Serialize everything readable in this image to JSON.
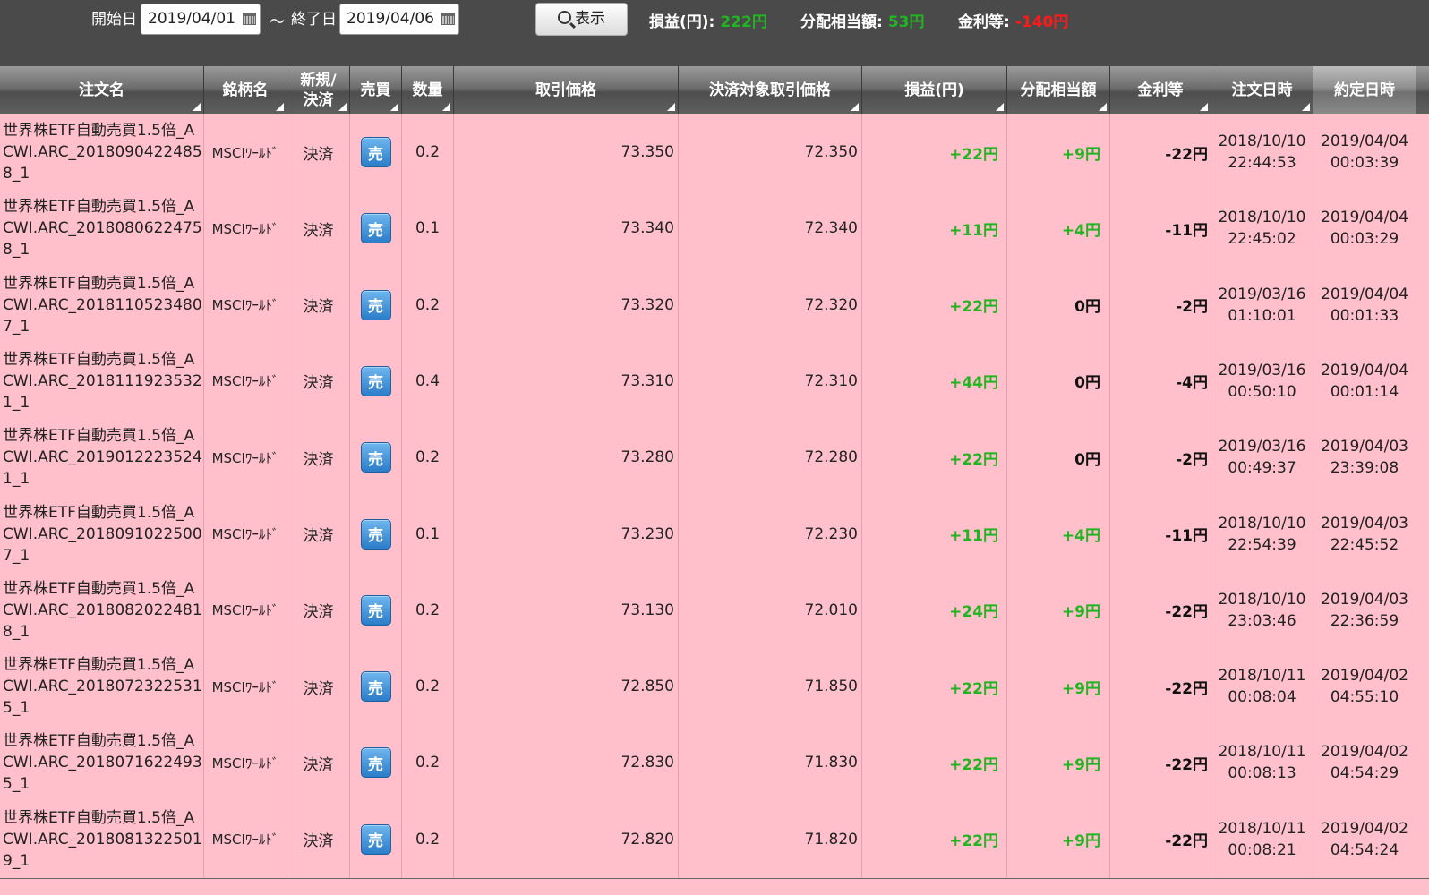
{
  "filter": {
    "start_label": "開始日",
    "start_value": "2019/04/01",
    "tilde": "〜",
    "end_label": "終了日",
    "end_value": "2019/04/06",
    "search_label": "表示"
  },
  "summary": {
    "pl_label": "損益(円):",
    "pl_value": "222円",
    "div_label": "分配相当額:",
    "div_value": "53円",
    "int_label": "金利等:",
    "int_value": "-140円",
    "colors": {
      "positive": "#22b422",
      "negative": "#ff1a1a"
    }
  },
  "columns": {
    "name": "注文名",
    "issue": "銘柄名",
    "type": "新規/決済",
    "side": "売買",
    "qty": "数量",
    "price": "取引価格",
    "sprice": "決済対象取引価格",
    "pl": "損益(円)",
    "div": "分配相当額",
    "int": "金利等",
    "odt": "注文日時",
    "edt": "約定日時"
  },
  "rows": [
    {
      "name": "世界株ETF自動売買1.5倍_ACWI.ARC_20180904224858_1",
      "issue": "MSCIﾜｰﾙﾄﾞ",
      "type": "決済",
      "side": "売",
      "qty": "0.2",
      "price": "73.350",
      "sprice": "72.350",
      "pl": "+22円",
      "div": "+9円",
      "int": "-22円",
      "odt_d": "2018/10/10",
      "odt_t": "22:44:53",
      "edt_d": "2019/04/04",
      "edt_t": "00:03:39"
    },
    {
      "name": "世界株ETF自動売買1.5倍_ACWI.ARC_20180806224758_1",
      "issue": "MSCIﾜｰﾙﾄﾞ",
      "type": "決済",
      "side": "売",
      "qty": "0.1",
      "price": "73.340",
      "sprice": "72.340",
      "pl": "+11円",
      "div": "+4円",
      "int": "-11円",
      "odt_d": "2018/10/10",
      "odt_t": "22:45:02",
      "edt_d": "2019/04/04",
      "edt_t": "00:03:29"
    },
    {
      "name": "世界株ETF自動売買1.5倍_ACWI.ARC_20181105234807_1",
      "issue": "MSCIﾜｰﾙﾄﾞ",
      "type": "決済",
      "side": "売",
      "qty": "0.2",
      "price": "73.320",
      "sprice": "72.320",
      "pl": "+22円",
      "div": "0円",
      "int": "-2円",
      "odt_d": "2019/03/16",
      "odt_t": "01:10:01",
      "edt_d": "2019/04/04",
      "edt_t": "00:01:33"
    },
    {
      "name": "世界株ETF自動売買1.5倍_ACWI.ARC_20181119235321_1",
      "issue": "MSCIﾜｰﾙﾄﾞ",
      "type": "決済",
      "side": "売",
      "qty": "0.4",
      "price": "73.310",
      "sprice": "72.310",
      "pl": "+44円",
      "div": "0円",
      "int": "-4円",
      "odt_d": "2019/03/16",
      "odt_t": "00:50:10",
      "edt_d": "2019/04/04",
      "edt_t": "00:01:14"
    },
    {
      "name": "世界株ETF自動売買1.5倍_ACWI.ARC_20190122235241_1",
      "issue": "MSCIﾜｰﾙﾄﾞ",
      "type": "決済",
      "side": "売",
      "qty": "0.2",
      "price": "73.280",
      "sprice": "72.280",
      "pl": "+22円",
      "div": "0円",
      "int": "-2円",
      "odt_d": "2019/03/16",
      "odt_t": "00:49:37",
      "edt_d": "2019/04/03",
      "edt_t": "23:39:08"
    },
    {
      "name": "世界株ETF自動売買1.5倍_ACWI.ARC_20180910225007_1",
      "issue": "MSCIﾜｰﾙﾄﾞ",
      "type": "決済",
      "side": "売",
      "qty": "0.1",
      "price": "73.230",
      "sprice": "72.230",
      "pl": "+11円",
      "div": "+4円",
      "int": "-11円",
      "odt_d": "2018/10/10",
      "odt_t": "22:54:39",
      "edt_d": "2019/04/03",
      "edt_t": "22:45:52"
    },
    {
      "name": "世界株ETF自動売買1.5倍_ACWI.ARC_20180820224818_1",
      "issue": "MSCIﾜｰﾙﾄﾞ",
      "type": "決済",
      "side": "売",
      "qty": "0.2",
      "price": "73.130",
      "sprice": "72.010",
      "pl": "+24円",
      "div": "+9円",
      "int": "-22円",
      "odt_d": "2018/10/10",
      "odt_t": "23:03:46",
      "edt_d": "2019/04/03",
      "edt_t": "22:36:59"
    },
    {
      "name": "世界株ETF自動売買1.5倍_ACWI.ARC_20180723225315_1",
      "issue": "MSCIﾜｰﾙﾄﾞ",
      "type": "決済",
      "side": "売",
      "qty": "0.2",
      "price": "72.850",
      "sprice": "71.850",
      "pl": "+22円",
      "div": "+9円",
      "int": "-22円",
      "odt_d": "2018/10/11",
      "odt_t": "00:08:04",
      "edt_d": "2019/04/02",
      "edt_t": "04:55:10"
    },
    {
      "name": "世界株ETF自動売買1.5倍_ACWI.ARC_20180716224935_1",
      "issue": "MSCIﾜｰﾙﾄﾞ",
      "type": "決済",
      "side": "売",
      "qty": "0.2",
      "price": "72.830",
      "sprice": "71.830",
      "pl": "+22円",
      "div": "+9円",
      "int": "-22円",
      "odt_d": "2018/10/11",
      "odt_t": "00:08:13",
      "edt_d": "2019/04/02",
      "edt_t": "04:54:29"
    },
    {
      "name": "世界株ETF自動売買1.5倍_ACWI.ARC_20180813225019_1",
      "issue": "MSCIﾜｰﾙﾄﾞ",
      "type": "決済",
      "side": "売",
      "qty": "0.2",
      "price": "72.820",
      "sprice": "71.820",
      "pl": "+22円",
      "div": "+9円",
      "int": "-22円",
      "odt_d": "2018/10/11",
      "odt_t": "00:08:21",
      "edt_d": "2019/04/02",
      "edt_t": "04:54:24"
    }
  ]
}
